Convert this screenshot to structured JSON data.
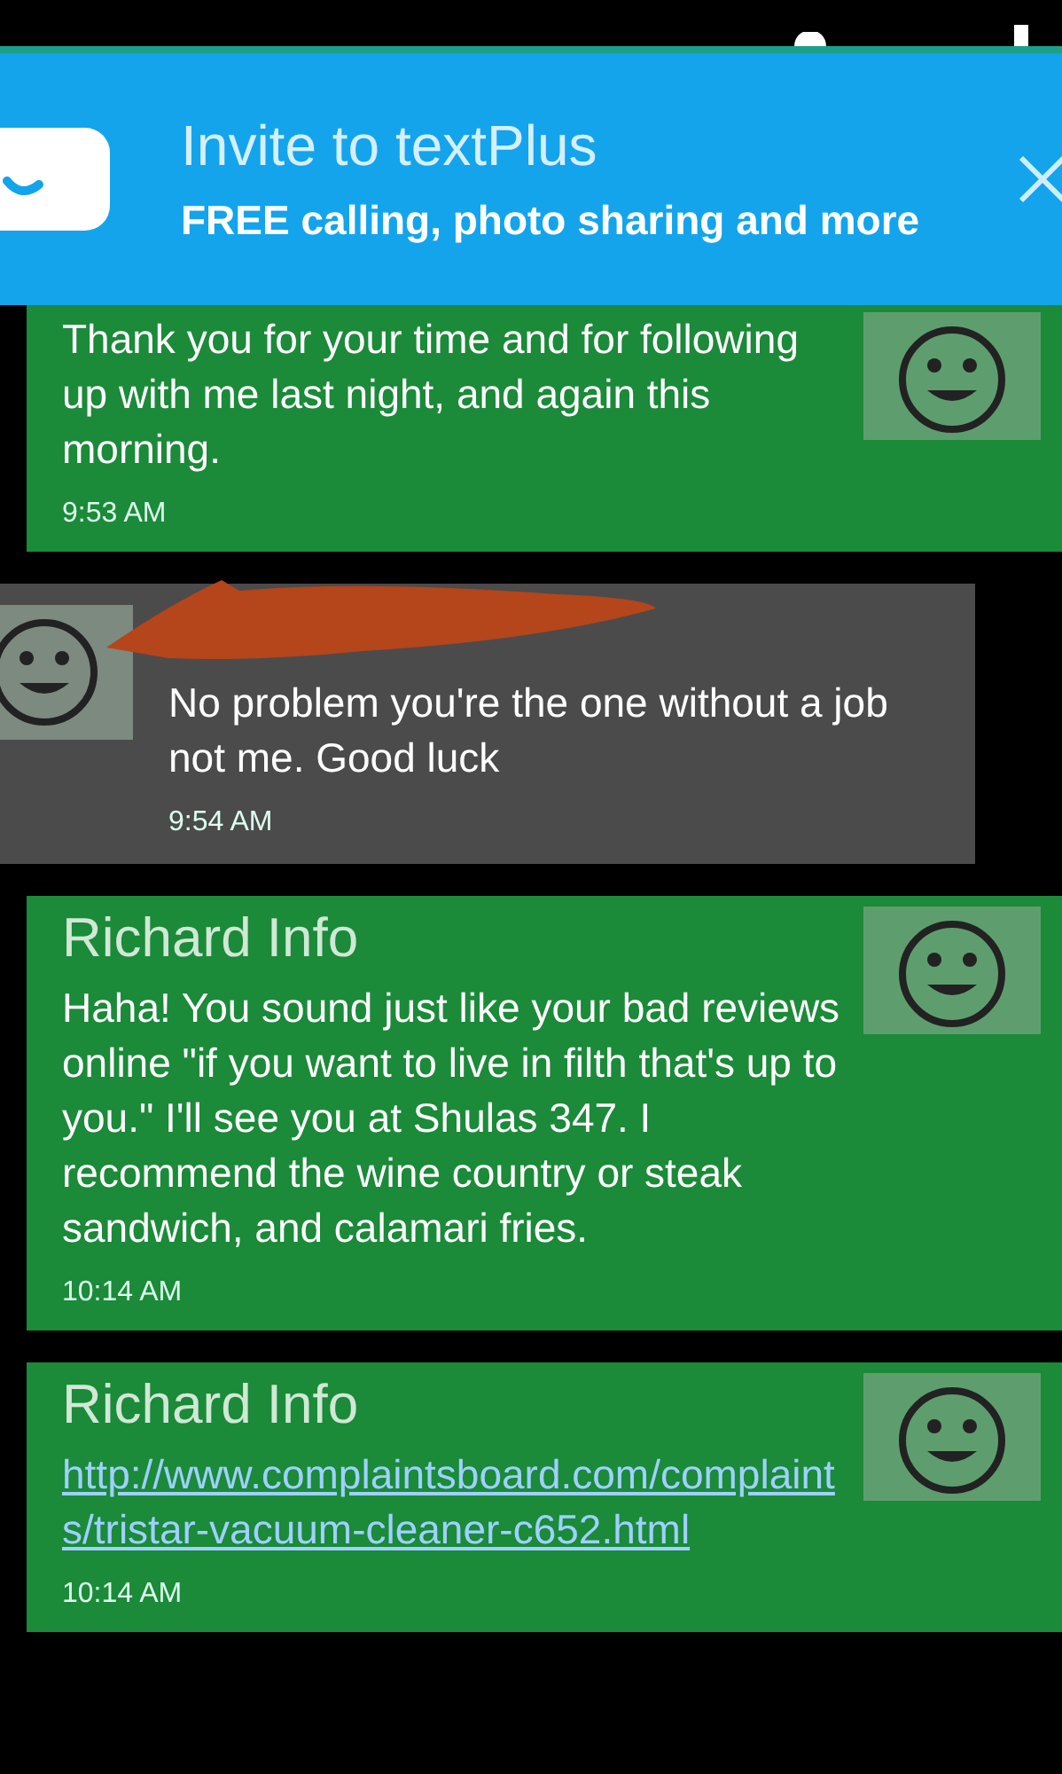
{
  "banner": {
    "title": "Invite to textPlus",
    "subtitle": "FREE calling, photo sharing and more"
  },
  "messages": [
    {
      "kind": "received",
      "body": {
        "kind": "text",
        "text": "Thank you for your time and for following up with me last night, and again this morning."
      },
      "time": "9:53 AM"
    },
    {
      "kind": "sent",
      "redacted": true,
      "body": {
        "kind": "text",
        "text": "No problem you're the one without a job not me. Good luck"
      },
      "time": "9:54 AM"
    },
    {
      "kind": "received",
      "sender": "Richard Info",
      "body": {
        "kind": "text",
        "text": "Haha! You sound just like your bad reviews online \"if you want to live in filth that's up to you.\" I'll see you at Shulas 347. I recommend the wine country or steak sandwich, and calamari fries."
      },
      "time": "10:14 AM"
    },
    {
      "kind": "received",
      "sender": "Richard Info",
      "body": {
        "kind": "link",
        "text": "http://www.complaintsboard.com/complaints/tristar-vacuum-cleaner-c652.html"
      },
      "time": "10:14 AM"
    }
  ]
}
